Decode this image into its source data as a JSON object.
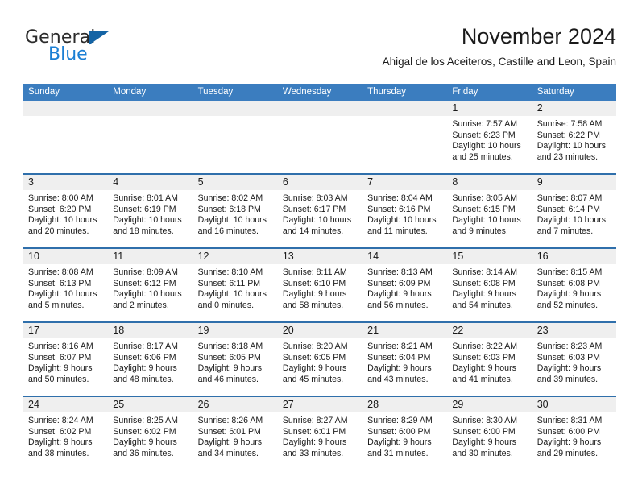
{
  "logo": {
    "word_one": "General",
    "word_two": "Blue",
    "triangle_color": "#1464a5",
    "blue_color": "#1b7fd4"
  },
  "header": {
    "title": "November 2024",
    "subtitle": "Ahigal de los Aceiteros, Castille and Leon, Spain"
  },
  "theme": {
    "header_bg": "#3b7dbf",
    "row_divider": "#2f6fab",
    "day_band_bg": "#efefef"
  },
  "weekdays": [
    "Sunday",
    "Monday",
    "Tuesday",
    "Wednesday",
    "Thursday",
    "Friday",
    "Saturday"
  ],
  "weeks": [
    [
      {
        "day": "",
        "lines": []
      },
      {
        "day": "",
        "lines": []
      },
      {
        "day": "",
        "lines": []
      },
      {
        "day": "",
        "lines": []
      },
      {
        "day": "",
        "lines": []
      },
      {
        "day": "1",
        "lines": [
          "Sunrise: 7:57 AM",
          "Sunset: 6:23 PM",
          "Daylight: 10 hours",
          "and 25 minutes."
        ]
      },
      {
        "day": "2",
        "lines": [
          "Sunrise: 7:58 AM",
          "Sunset: 6:22 PM",
          "Daylight: 10 hours",
          "and 23 minutes."
        ]
      }
    ],
    [
      {
        "day": "3",
        "lines": [
          "Sunrise: 8:00 AM",
          "Sunset: 6:20 PM",
          "Daylight: 10 hours",
          "and 20 minutes."
        ]
      },
      {
        "day": "4",
        "lines": [
          "Sunrise: 8:01 AM",
          "Sunset: 6:19 PM",
          "Daylight: 10 hours",
          "and 18 minutes."
        ]
      },
      {
        "day": "5",
        "lines": [
          "Sunrise: 8:02 AM",
          "Sunset: 6:18 PM",
          "Daylight: 10 hours",
          "and 16 minutes."
        ]
      },
      {
        "day": "6",
        "lines": [
          "Sunrise: 8:03 AM",
          "Sunset: 6:17 PM",
          "Daylight: 10 hours",
          "and 14 minutes."
        ]
      },
      {
        "day": "7",
        "lines": [
          "Sunrise: 8:04 AM",
          "Sunset: 6:16 PM",
          "Daylight: 10 hours",
          "and 11 minutes."
        ]
      },
      {
        "day": "8",
        "lines": [
          "Sunrise: 8:05 AM",
          "Sunset: 6:15 PM",
          "Daylight: 10 hours",
          "and 9 minutes."
        ]
      },
      {
        "day": "9",
        "lines": [
          "Sunrise: 8:07 AM",
          "Sunset: 6:14 PM",
          "Daylight: 10 hours",
          "and 7 minutes."
        ]
      }
    ],
    [
      {
        "day": "10",
        "lines": [
          "Sunrise: 8:08 AM",
          "Sunset: 6:13 PM",
          "Daylight: 10 hours",
          "and 5 minutes."
        ]
      },
      {
        "day": "11",
        "lines": [
          "Sunrise: 8:09 AM",
          "Sunset: 6:12 PM",
          "Daylight: 10 hours",
          "and 2 minutes."
        ]
      },
      {
        "day": "12",
        "lines": [
          "Sunrise: 8:10 AM",
          "Sunset: 6:11 PM",
          "Daylight: 10 hours",
          "and 0 minutes."
        ]
      },
      {
        "day": "13",
        "lines": [
          "Sunrise: 8:11 AM",
          "Sunset: 6:10 PM",
          "Daylight: 9 hours",
          "and 58 minutes."
        ]
      },
      {
        "day": "14",
        "lines": [
          "Sunrise: 8:13 AM",
          "Sunset: 6:09 PM",
          "Daylight: 9 hours",
          "and 56 minutes."
        ]
      },
      {
        "day": "15",
        "lines": [
          "Sunrise: 8:14 AM",
          "Sunset: 6:08 PM",
          "Daylight: 9 hours",
          "and 54 minutes."
        ]
      },
      {
        "day": "16",
        "lines": [
          "Sunrise: 8:15 AM",
          "Sunset: 6:08 PM",
          "Daylight: 9 hours",
          "and 52 minutes."
        ]
      }
    ],
    [
      {
        "day": "17",
        "lines": [
          "Sunrise: 8:16 AM",
          "Sunset: 6:07 PM",
          "Daylight: 9 hours",
          "and 50 minutes."
        ]
      },
      {
        "day": "18",
        "lines": [
          "Sunrise: 8:17 AM",
          "Sunset: 6:06 PM",
          "Daylight: 9 hours",
          "and 48 minutes."
        ]
      },
      {
        "day": "19",
        "lines": [
          "Sunrise: 8:18 AM",
          "Sunset: 6:05 PM",
          "Daylight: 9 hours",
          "and 46 minutes."
        ]
      },
      {
        "day": "20",
        "lines": [
          "Sunrise: 8:20 AM",
          "Sunset: 6:05 PM",
          "Daylight: 9 hours",
          "and 45 minutes."
        ]
      },
      {
        "day": "21",
        "lines": [
          "Sunrise: 8:21 AM",
          "Sunset: 6:04 PM",
          "Daylight: 9 hours",
          "and 43 minutes."
        ]
      },
      {
        "day": "22",
        "lines": [
          "Sunrise: 8:22 AM",
          "Sunset: 6:03 PM",
          "Daylight: 9 hours",
          "and 41 minutes."
        ]
      },
      {
        "day": "23",
        "lines": [
          "Sunrise: 8:23 AM",
          "Sunset: 6:03 PM",
          "Daylight: 9 hours",
          "and 39 minutes."
        ]
      }
    ],
    [
      {
        "day": "24",
        "lines": [
          "Sunrise: 8:24 AM",
          "Sunset: 6:02 PM",
          "Daylight: 9 hours",
          "and 38 minutes."
        ]
      },
      {
        "day": "25",
        "lines": [
          "Sunrise: 8:25 AM",
          "Sunset: 6:02 PM",
          "Daylight: 9 hours",
          "and 36 minutes."
        ]
      },
      {
        "day": "26",
        "lines": [
          "Sunrise: 8:26 AM",
          "Sunset: 6:01 PM",
          "Daylight: 9 hours",
          "and 34 minutes."
        ]
      },
      {
        "day": "27",
        "lines": [
          "Sunrise: 8:27 AM",
          "Sunset: 6:01 PM",
          "Daylight: 9 hours",
          "and 33 minutes."
        ]
      },
      {
        "day": "28",
        "lines": [
          "Sunrise: 8:29 AM",
          "Sunset: 6:00 PM",
          "Daylight: 9 hours",
          "and 31 minutes."
        ]
      },
      {
        "day": "29",
        "lines": [
          "Sunrise: 8:30 AM",
          "Sunset: 6:00 PM",
          "Daylight: 9 hours",
          "and 30 minutes."
        ]
      },
      {
        "day": "30",
        "lines": [
          "Sunrise: 8:31 AM",
          "Sunset: 6:00 PM",
          "Daylight: 9 hours",
          "and 29 minutes."
        ]
      }
    ]
  ]
}
